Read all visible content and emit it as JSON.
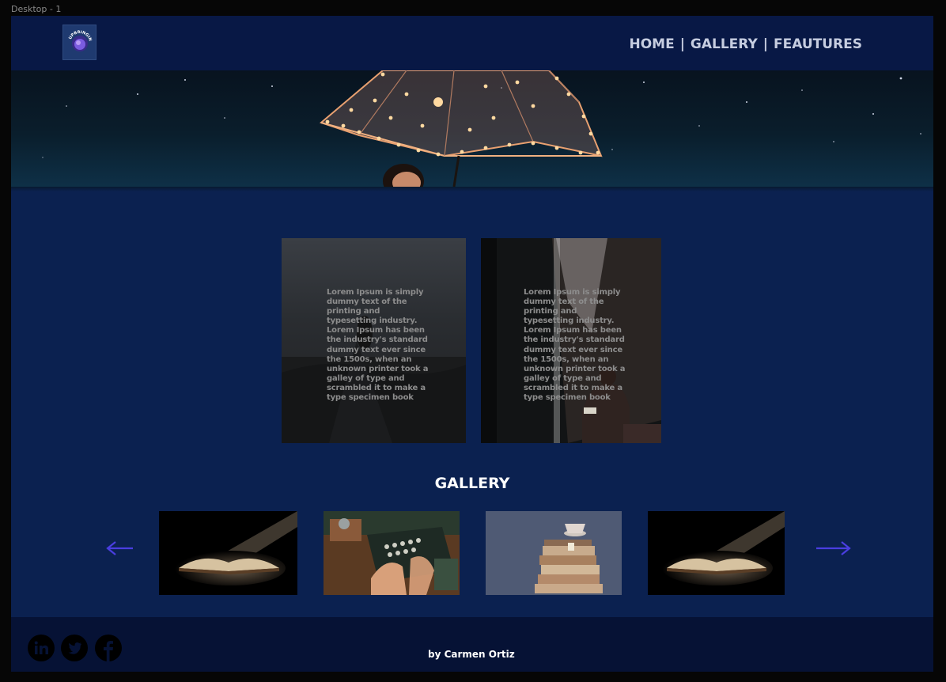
{
  "frame": {
    "label": "Desktop - 1"
  },
  "header": {
    "logo_text": "UPBRINGING",
    "nav": [
      {
        "label": "HOME"
      },
      {
        "label": "GALLERY"
      },
      {
        "label": "FEAUTURES"
      }
    ],
    "separator": "|"
  },
  "cards": [
    {
      "text": "Lorem Ipsum is simply dummy text of the printing and typesetting industry. Lorem Ipsum has been the industry's standard dummy text ever since the 1500s, when an unknown printer took a galley of type and scrambled it to make a type specimen book"
    },
    {
      "text": "Lorem Ipsum is simply dummy text of the printing and typesetting industry. Lorem Ipsum has been the industry's standard dummy text ever since the 1500s, when an unknown printer took a galley of type and scrambled it to make a type specimen book"
    }
  ],
  "gallery": {
    "title": "GALLERY",
    "prev_icon": "arrow-left-icon",
    "next_icon": "arrow-right-icon",
    "images": [
      "open-book-in-light",
      "typewriter-hands",
      "stacked-books-teacup",
      "open-book-in-light"
    ]
  },
  "footer": {
    "social": [
      "linkedin-icon",
      "twitter-icon",
      "facebook-icon"
    ],
    "credit": "by Carmen Ortiz"
  },
  "colors": {
    "page_bg": "#0b2150",
    "header_bg": "#081845",
    "footer_bg": "#061235",
    "nav_text": "#c6cde0",
    "arrow": "#4a3ee0"
  }
}
